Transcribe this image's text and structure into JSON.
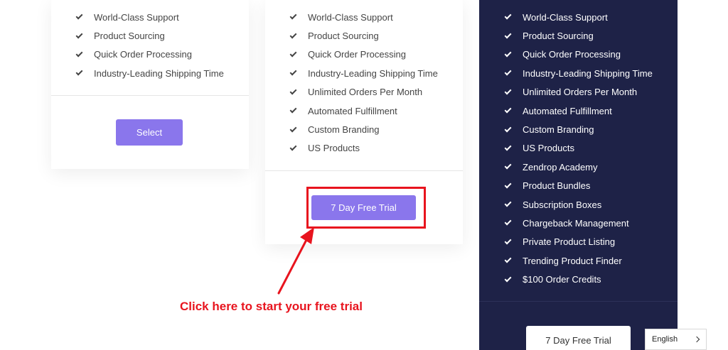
{
  "plans": [
    {
      "features": [
        "World-Class Support",
        "Product Sourcing",
        "Quick Order Processing",
        "Industry-Leading Shipping Time"
      ],
      "button_label": "Select"
    },
    {
      "features": [
        "World-Class Support",
        "Product Sourcing",
        "Quick Order Processing",
        "Industry-Leading Shipping Time",
        "Unlimited Orders Per Month",
        "Automated Fulfillment",
        "Custom Branding",
        "US Products"
      ],
      "button_label": "7 Day Free Trial"
    },
    {
      "features": [
        "World-Class Support",
        "Product Sourcing",
        "Quick Order Processing",
        "Industry-Leading Shipping Time",
        "Unlimited Orders Per Month",
        "Automated Fulfillment",
        "Custom Branding",
        "US Products",
        "Zendrop Academy",
        "Product Bundles",
        "Subscription Boxes",
        "Chargeback Management",
        "Private Product Listing",
        "Trending Product Finder",
        "$100 Order Credits"
      ],
      "button_label": "7 Day Free Trial"
    }
  ],
  "annotation": {
    "text": "Click here to start your free trial",
    "color": "#e8141e"
  },
  "language_selector": {
    "value": "English",
    "icon": "chevron-right-icon"
  },
  "colors": {
    "accent": "#8a76ec",
    "dark_card": "#1e2247",
    "annotation_red": "#e8141e"
  }
}
